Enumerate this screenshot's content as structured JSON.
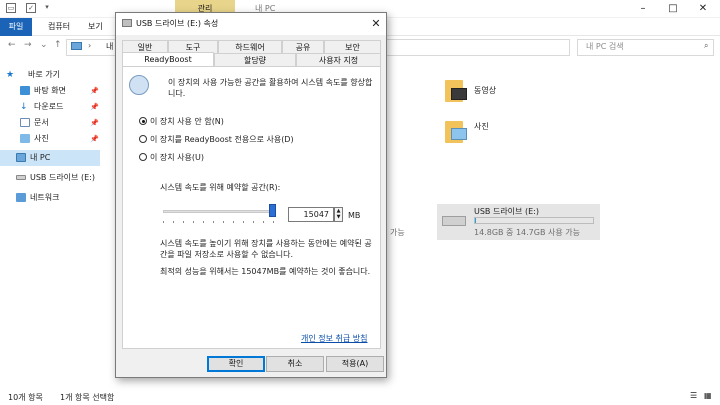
{
  "explorer": {
    "window_title": "내 PC",
    "manage_tab": "관리",
    "ribbon_tabs": [
      "파일",
      "컴퓨터",
      "보기"
    ],
    "address": "내 PC",
    "search_placeholder": "내 PC 검색",
    "sidebar": {
      "quick_access": "바로 가기",
      "items": [
        {
          "label": "바탕 화면",
          "icon": "desktop-icon",
          "pinned": true
        },
        {
          "label": "다운로드",
          "icon": "download-icon",
          "pinned": true
        },
        {
          "label": "문서",
          "icon": "document-icon",
          "pinned": true
        },
        {
          "label": "사진",
          "icon": "picture-icon",
          "pinned": true
        }
      ],
      "this_pc": "내 PC",
      "usb": "USB 드라이브 (E:)",
      "network": "네트워크"
    },
    "folders": [
      {
        "label": "동영상",
        "icon": "video-folder-icon"
      },
      {
        "label": "사진",
        "icon": "picture-folder-icon"
      }
    ],
    "left_avail": "가능",
    "drive": {
      "name": "USB 드라이브 (E:)",
      "size_text": "14.8GB 중 14.7GB 사용 가능",
      "used_fraction": 0.01
    },
    "status": {
      "items_count": "10개 항목",
      "selected": "1개 항목 선택함"
    }
  },
  "dialog": {
    "title": "USB 드라이브 (E:) 속성",
    "tabs_row1": [
      "일반",
      "도구",
      "하드웨어",
      "공유",
      "보안"
    ],
    "tabs_row2": [
      "ReadyBoost",
      "할당량",
      "사용자 지정"
    ],
    "active_tab": "ReadyBoost",
    "intro": "이 장치의 사용 가능한 공간을 활용하여 시스템 속도를 향상합니다.",
    "options": [
      {
        "label": "이 장치 사용 안 함(N)",
        "selected": true
      },
      {
        "label": "이 장치를 ReadyBoost 전용으로 사용(D)",
        "selected": false
      },
      {
        "label": "이 장치 사용(U)",
        "selected": false
      }
    ],
    "reserve_label": "시스템 속도를 위해 예약할 공간(R):",
    "reserve_value": "15047",
    "reserve_unit": "MB",
    "slider_fraction": 1.0,
    "note": "시스템 속도를 높이기 위해 장치를 사용하는 동안에는 예약된 공간을 파일 저장소로 사용할 수 없습니다.",
    "recommend": "최적의 성능을 위해서는 15047MB를 예약하는 것이 좋습니다.",
    "privacy_link": "개인 정보 취급 방침",
    "buttons": {
      "ok": "확인",
      "cancel": "취소",
      "apply": "적용(A)"
    }
  }
}
